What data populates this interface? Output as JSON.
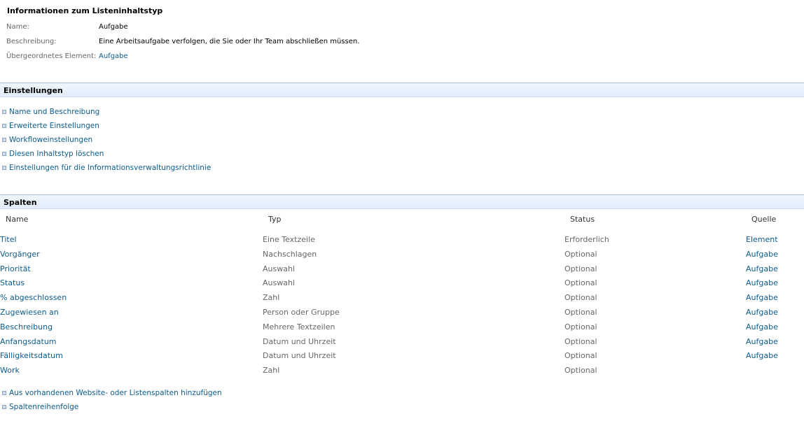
{
  "info": {
    "title": "Informationen zum Listeninhaltstyp",
    "name_label": "Name:",
    "name_value": "Aufgabe",
    "description_label": "Beschreibung:",
    "description_value": "Eine Arbeitsaufgabe verfolgen, die Sie oder Ihr Team abschließen müssen.",
    "parent_label": "Übergeordnetes Element:",
    "parent_value": "Aufgabe"
  },
  "settings": {
    "header": "Einstellungen",
    "items": [
      "Name und Beschreibung",
      "Erweiterte Einstellungen",
      "Workfloweinstellungen",
      "Diesen Inhaltstyp löschen",
      "Einstellungen für die Informationsverwaltungsrichtlinie"
    ]
  },
  "columns": {
    "header": "Spalten",
    "headers": {
      "name": "Name",
      "type": "Typ",
      "status": "Status",
      "source": "Quelle"
    },
    "rows": [
      {
        "name": "Titel",
        "type": "Eine Textzeile",
        "status": "Erforderlich",
        "source": "Element"
      },
      {
        "name": "Vorgänger",
        "type": "Nachschlagen",
        "status": "Optional",
        "source": "Aufgabe"
      },
      {
        "name": "Priorität",
        "type": "Auswahl",
        "status": "Optional",
        "source": "Aufgabe"
      },
      {
        "name": "Status",
        "type": "Auswahl",
        "status": "Optional",
        "source": "Aufgabe"
      },
      {
        "name": "% abgeschlossen",
        "type": "Zahl",
        "status": "Optional",
        "source": "Aufgabe"
      },
      {
        "name": "Zugewiesen an",
        "type": "Person oder Gruppe",
        "status": "Optional",
        "source": "Aufgabe"
      },
      {
        "name": "Beschreibung",
        "type": "Mehrere Textzeilen",
        "status": "Optional",
        "source": "Aufgabe"
      },
      {
        "name": "Anfangsdatum",
        "type": "Datum und Uhrzeit",
        "status": "Optional",
        "source": "Aufgabe"
      },
      {
        "name": "Fälligkeitsdatum",
        "type": "Datum und Uhrzeit",
        "status": "Optional",
        "source": "Aufgabe"
      },
      {
        "name": "Work",
        "type": "Zahl",
        "status": "Optional",
        "source": ""
      }
    ],
    "actions": [
      "Aus vorhandenen Website- oder Listenspalten hinzufügen",
      "Spaltenreihenfolge"
    ]
  },
  "colors": {
    "link": "#0b5b8e",
    "label_gray": "#676767",
    "section_header_bg": "#e1ecfa",
    "section_header_border": "#a5c3e8"
  }
}
